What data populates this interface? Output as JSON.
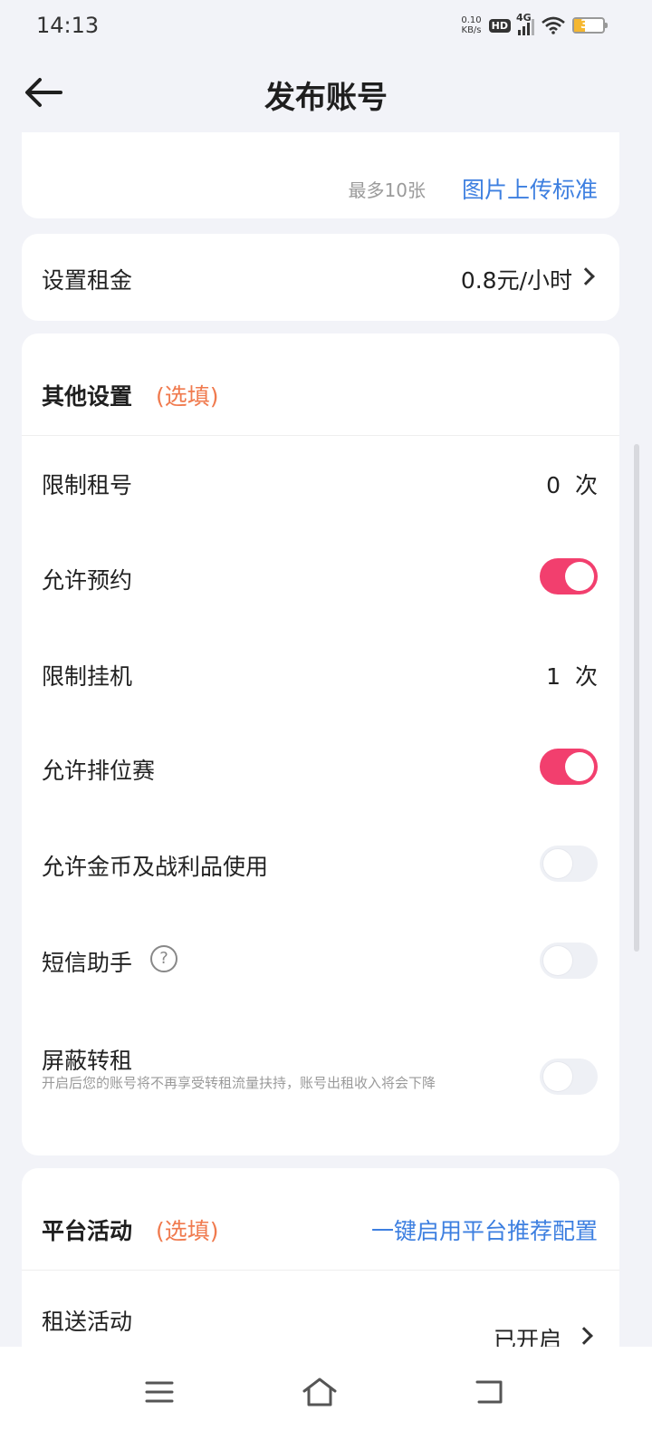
{
  "status_bar": {
    "time": "14:13",
    "net_speed_value": "0.10",
    "net_speed_unit": "KB/s",
    "hd": "HD",
    "network": "4G",
    "battery": "37",
    "battery_level": 0.37
  },
  "header": {
    "title": "发布账号",
    "back_icon": "arrow-left-icon"
  },
  "photos": {
    "hint": "最多10张",
    "link": "图片上传标准"
  },
  "rent": {
    "label": "设置租金",
    "value": "0.8元/小时"
  },
  "other_settings": {
    "title": "其他设置",
    "optional": "(选填)",
    "rows": [
      {
        "label": "限制租号",
        "type": "value",
        "value": "0",
        "unit": "次"
      },
      {
        "label": "允许预约",
        "type": "toggle",
        "on": true
      },
      {
        "label": "限制挂机",
        "type": "value",
        "value": "1",
        "unit": "次"
      },
      {
        "label": "允许排位赛",
        "type": "toggle",
        "on": true
      },
      {
        "label": "允许金币及战利品使用",
        "type": "toggle",
        "on": false
      },
      {
        "label": "短信助手",
        "type": "toggle",
        "on": false,
        "help": "?"
      },
      {
        "label": "屏蔽转租",
        "type": "toggle",
        "on": false,
        "desc": "开启后您的账号将不再享受转租流量扶持，账号出租收入将会下降"
      }
    ]
  },
  "platform": {
    "title": "平台活动",
    "optional": "(选填)",
    "link": "一键启用平台推荐配置",
    "activity_label": "租送活动",
    "activity_value": "已开启"
  },
  "colors": {
    "accent_pink": "#f23f6e",
    "link_blue": "#3d7fe0",
    "optional_orange": "#f07a4e"
  }
}
